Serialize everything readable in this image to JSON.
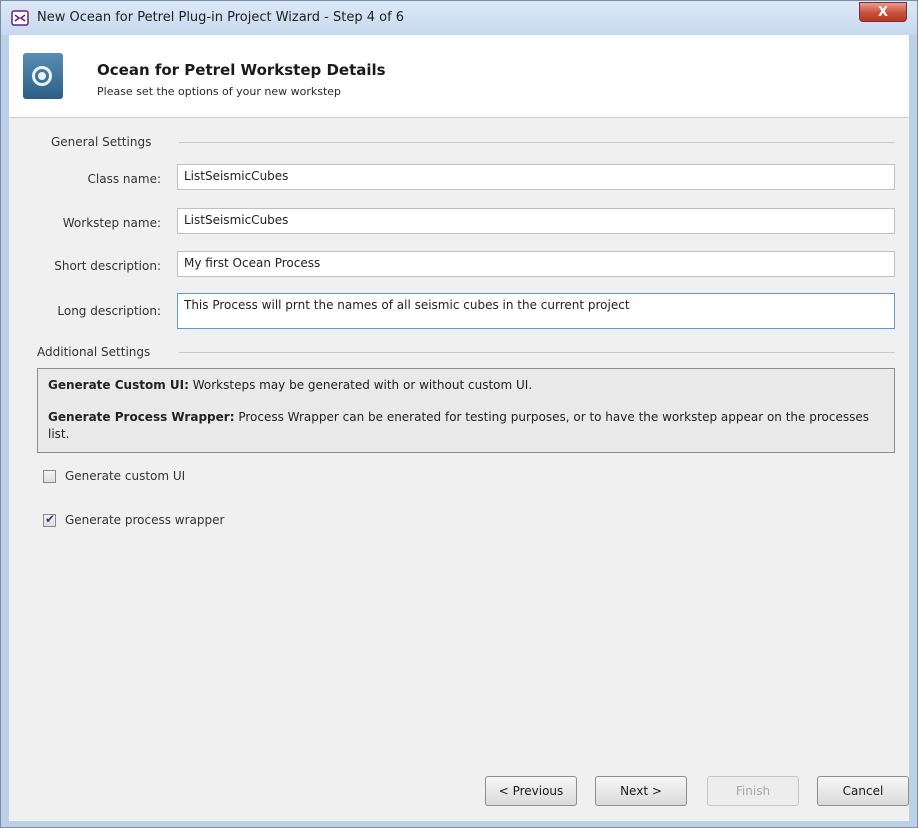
{
  "window": {
    "title": "New Ocean for Petrel Plug-in Project Wizard - Step 4 of 6",
    "close_label": "X"
  },
  "header": {
    "title": "Ocean for Petrel Workstep Details",
    "subtitle": "Please set the options of your new workstep"
  },
  "general": {
    "section_label": "General Settings",
    "class_name": {
      "label": "Class name:",
      "value": "ListSeismicCubes"
    },
    "workstep_name": {
      "label": "Workstep name:",
      "value": "ListSeismicCubes"
    },
    "short_description": {
      "label": "Short description:",
      "value": "My first Ocean Process"
    },
    "long_description": {
      "label": "Long description:",
      "value": "This Process will prnt the names of all seismic cubes in the current project"
    }
  },
  "additional": {
    "section_label": "Additional Settings",
    "info": {
      "custom_ui_heading": "Generate Custom UI:",
      "custom_ui_text": " Worksteps may be generated with or without custom UI.",
      "wrapper_heading": "Generate Process Wrapper:",
      "wrapper_text": " Process Wrapper can be enerated for testing purposes, or to have the workstep appear on the processes list."
    },
    "checkboxes": [
      {
        "label": "Generate custom UI",
        "checked": false
      },
      {
        "label": "Generate process wrapper",
        "checked": true
      }
    ]
  },
  "buttons": {
    "previous": "< Previous",
    "next": "Next >",
    "finish": "Finish",
    "cancel": "Cancel"
  },
  "colors": {
    "accent": "#5a9bd5",
    "close_button": "#c7503a"
  }
}
